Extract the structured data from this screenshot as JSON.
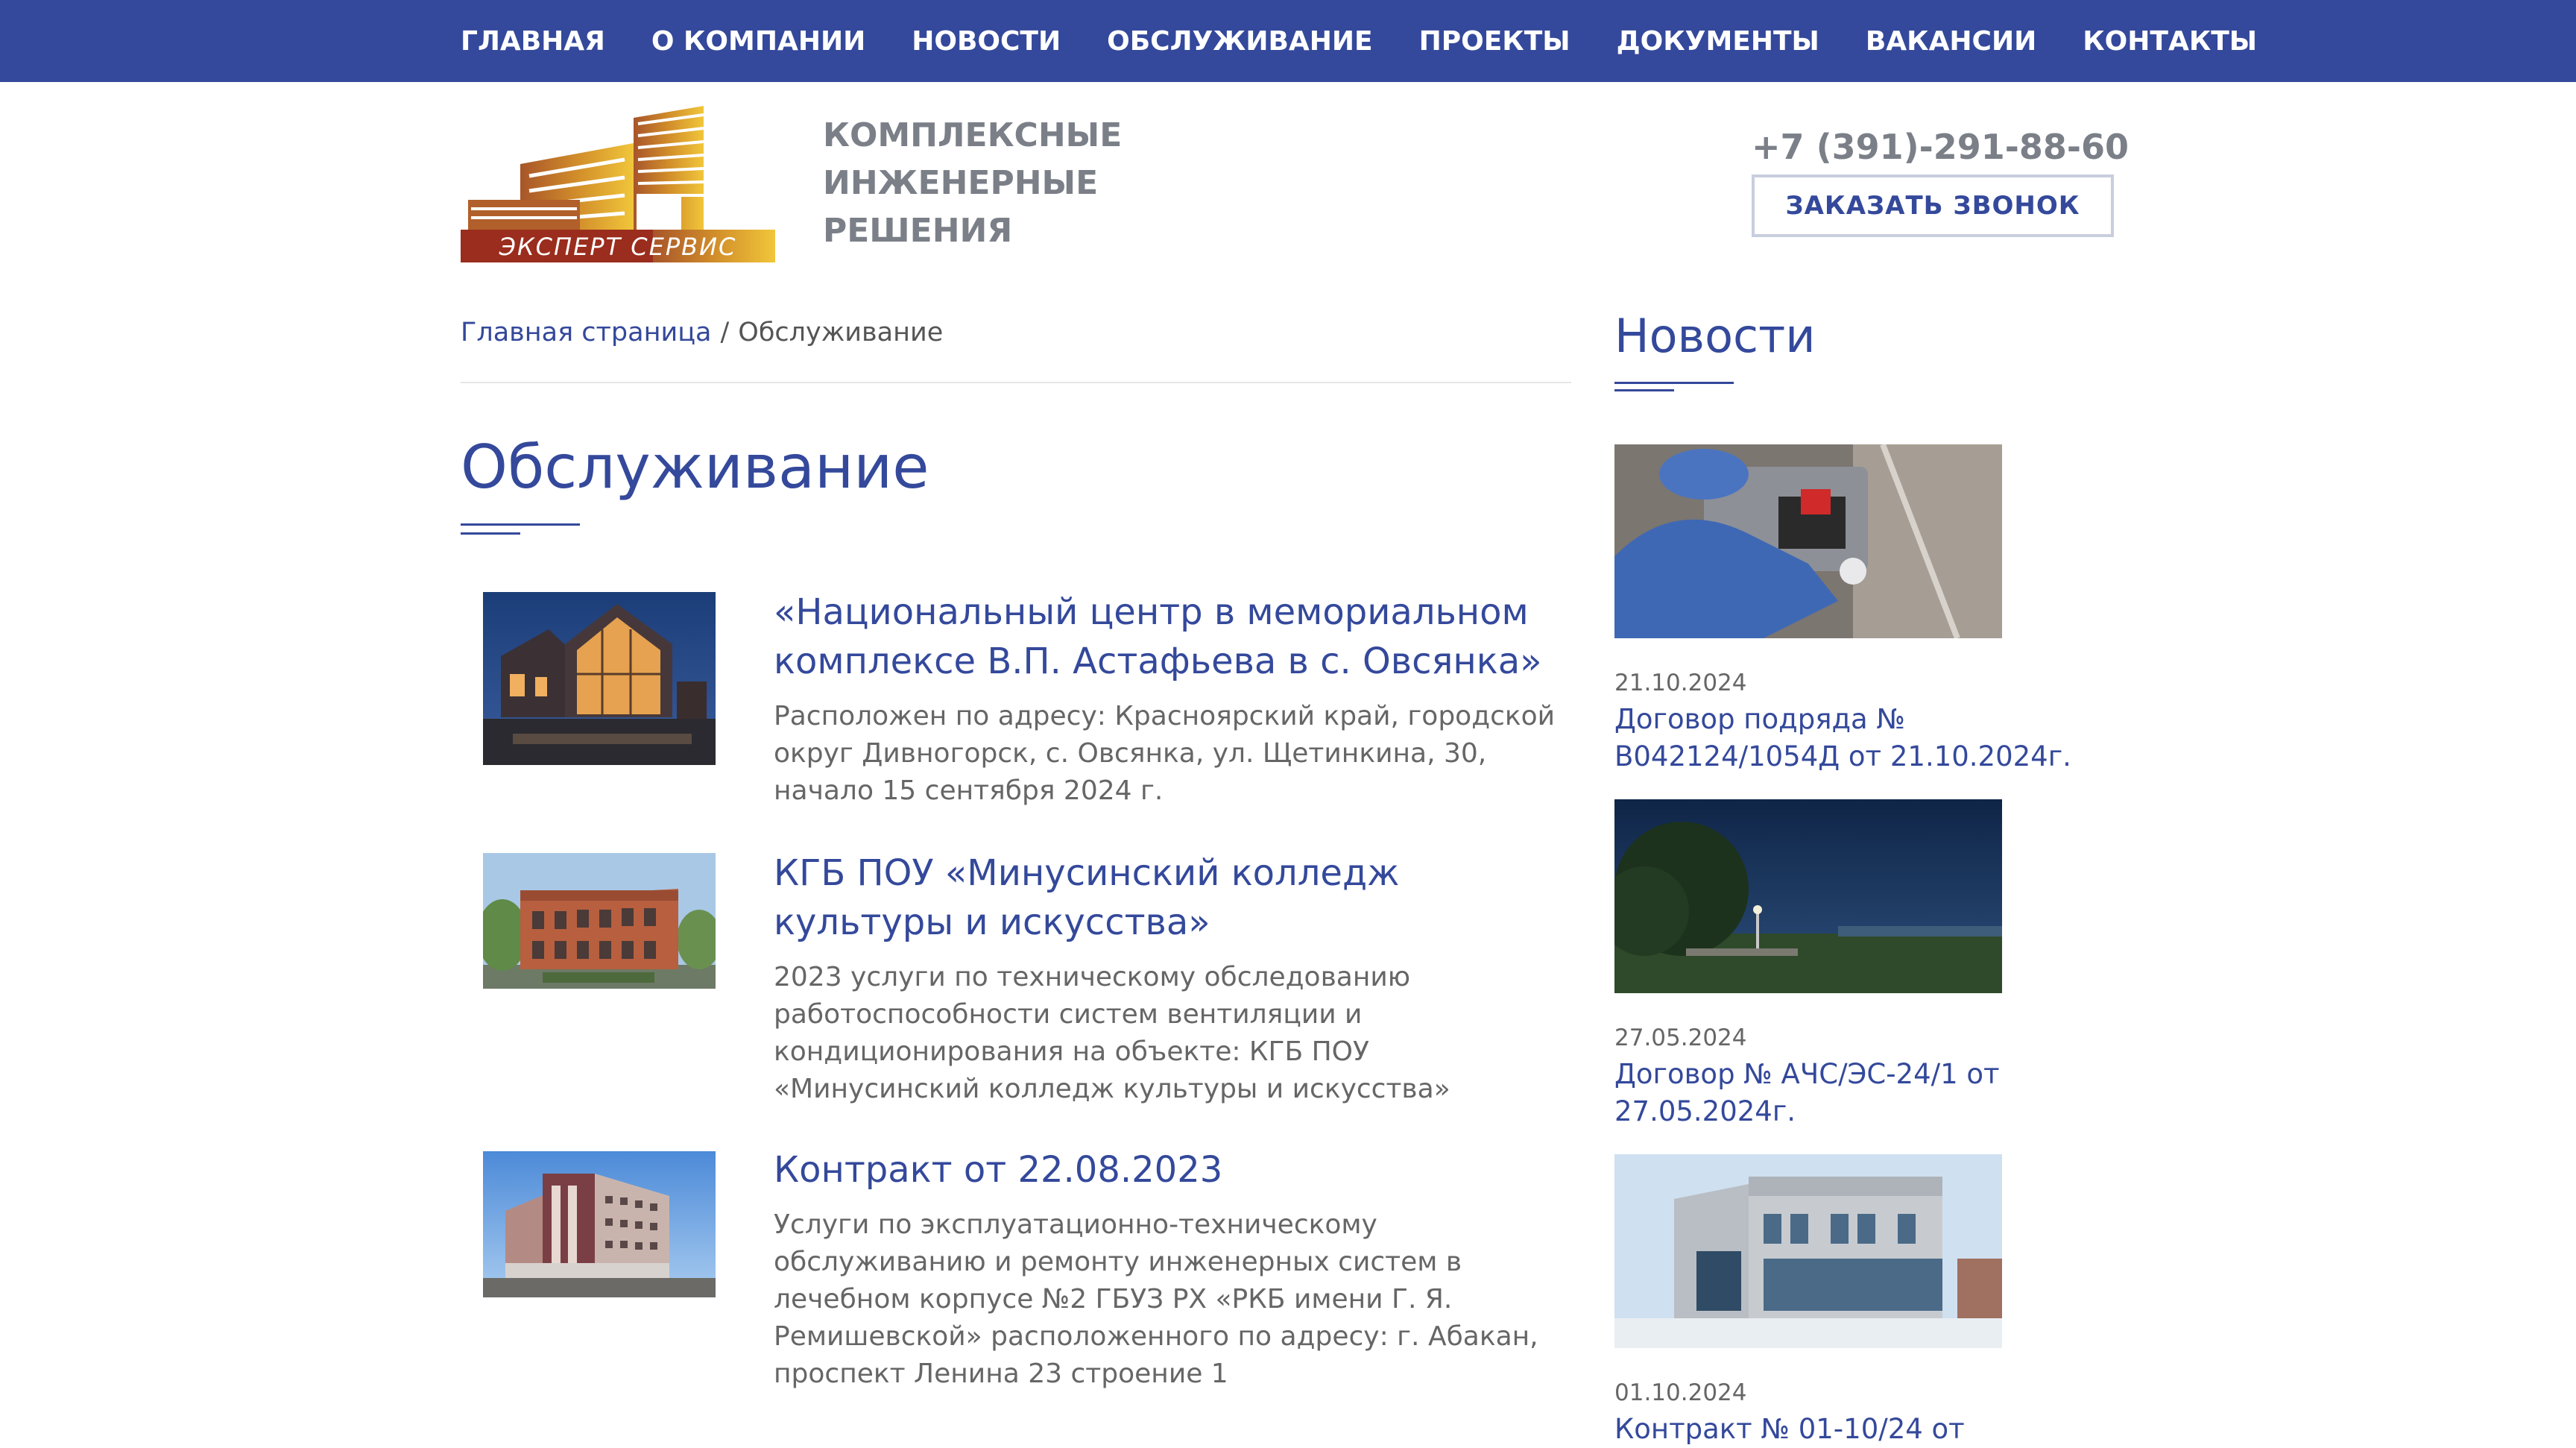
{
  "nav": {
    "items": [
      {
        "label": "ГЛАВНАЯ"
      },
      {
        "label": "О КОМПАНИИ"
      },
      {
        "label": "НОВОСТИ"
      },
      {
        "label": "ОБСЛУЖИВАНИЕ"
      },
      {
        "label": "ПРОЕКТЫ"
      },
      {
        "label": "ДОКУМЕНТЫ"
      },
      {
        "label": "ВАКАНСИИ"
      },
      {
        "label": "КОНТАКТЫ"
      }
    ]
  },
  "header": {
    "logo_text": "ЭКСПЕРТ СЕРВИС",
    "tagline": [
      "КОМПЛЕКСНЫЕ",
      "ИНЖЕНЕРНЫЕ",
      "РЕШЕНИЯ"
    ],
    "phone": "+7 (391)-291-88-60",
    "callback_label": "ЗАКАЗАТЬ ЗВОНОК"
  },
  "breadcrumb": {
    "home": "Главная страница",
    "separator": "/",
    "current": "Обслуживание"
  },
  "page": {
    "title": "Обслуживание"
  },
  "items": [
    {
      "title": "«Национальный центр в мемориальном комплексе В.П. Астафьева в с. Овсянка»",
      "desc": "Расположен по адресу: Красноярский край, городской округ Дивногорск, с. Овсянка, ул. Щетинкина, 30, начало 15 сентября 2024 г."
    },
    {
      "title": "КГБ ПОУ «Минусинский колледж культуры и искусства»",
      "desc": "2023 услуги по техническому обследованию работоспособности систем вентиляции и кондиционирования на объекте: КГБ ПОУ «Минусинский колледж культуры и искусства»"
    },
    {
      "title": "Контракт от 22.08.2023",
      "desc": "Услуги по эксплуатационно-техническому обслуживанию и ремонту инженерных систем в лечебном корпусе №2 ГБУЗ РХ «РКБ имени Г. Я. Ремишевской» расположенного по адресу: г. Абакан, проспект Ленина 23 строение 1"
    }
  ],
  "sidebar": {
    "title": "Новости",
    "news": [
      {
        "date": "21.10.2024",
        "title": "Договор подряда № В042124/1054Д от 21.10.2024г."
      },
      {
        "date": "27.05.2024",
        "title": "Договор № АЧС/ЭС-24/1 от 27.05.2024г."
      },
      {
        "date": "01.10.2024",
        "title": "Контракт № 01-10/24 от"
      }
    ]
  },
  "colors": {
    "brand_blue": "#34499b",
    "logo_red": "#9a2d1d",
    "logo_gold": "#d9a326"
  }
}
